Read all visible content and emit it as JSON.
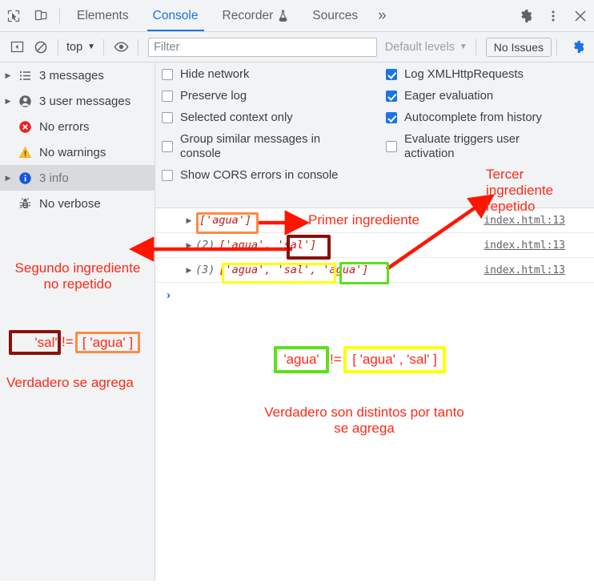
{
  "tabbar": {
    "icons": [
      "inspect-element-icon",
      "device-toolbar-icon"
    ],
    "tabs": [
      {
        "label": "Elements",
        "active": false
      },
      {
        "label": "Console",
        "active": true
      },
      {
        "label": "Recorder",
        "active": false,
        "badge": "flask-icon"
      },
      {
        "label": "Sources",
        "active": false
      }
    ],
    "more_tabs": "»",
    "settings_icon": "gear-icon",
    "kebab_icon": "more-vertical-icon",
    "close_icon": "close-icon"
  },
  "filterbar": {
    "sidebar_toggle_icon": "show-console-sidebar-icon",
    "clear_icon": "clear-console-icon",
    "context": "top",
    "context_caret": "▼",
    "eye_icon": "live-expression-icon",
    "filter_value": "",
    "filter_placeholder": "Filter",
    "levels_label": "Default levels",
    "levels_caret": "▼",
    "issues_label": "No Issues",
    "settings_icon": "console-settings-gear-icon"
  },
  "sidebar": {
    "items": [
      {
        "label": "3 messages",
        "icon": "list-icon",
        "expandable": true,
        "selected": false
      },
      {
        "label": "3 user messages",
        "icon": "user-icon",
        "expandable": true,
        "selected": false
      },
      {
        "label": "No errors",
        "icon": "error-icon",
        "expandable": false,
        "selected": false
      },
      {
        "label": "No warnings",
        "icon": "warning-icon",
        "expandable": false,
        "selected": false
      },
      {
        "label": "3 info",
        "icon": "info-icon",
        "expandable": true,
        "selected": true
      },
      {
        "label": "No verbose",
        "icon": "bug-icon",
        "expandable": false,
        "selected": false
      }
    ]
  },
  "settings": {
    "left": [
      {
        "label": "Hide network",
        "checked": false
      },
      {
        "label": "Preserve log",
        "checked": false
      },
      {
        "label": "Selected context only",
        "checked": false
      },
      {
        "label": "Group similar messages in\nconsole",
        "checked": false,
        "two_line": true
      },
      {
        "label": "Show CORS errors in console",
        "checked": false
      }
    ],
    "right": [
      {
        "label": "Log XMLHttpRequests",
        "checked": true
      },
      {
        "label": "Eager evaluation",
        "checked": true
      },
      {
        "label": "Autocomplete from history",
        "checked": true
      },
      {
        "label": "Evaluate triggers user\nactivation",
        "checked": false,
        "two_line": true
      }
    ]
  },
  "console_log": {
    "rows": [
      {
        "count": "",
        "text": "['agua']",
        "source": "index.html:13"
      },
      {
        "count": "(2)",
        "text": "['agua', 'sal']",
        "source": "index.html:13"
      },
      {
        "count": "(3)",
        "text": "['agua', 'sal', 'agua']",
        "source": "index.html:13"
      }
    ],
    "prompt": "›"
  },
  "annotations": {
    "colors": {
      "red": "#ff2a18",
      "orange": "#fb8c46",
      "darkred": "#8b1008",
      "yellow": "#ffff00",
      "green": "#5ce01a"
    },
    "primer": "Primer ingrediente",
    "tercer": "Tercer\ningrediente\nrepetido",
    "segundo": "Segundo ingrediente\nno repetido",
    "expr_left_a": "'sal'",
    "expr_left_op": "!=",
    "expr_left_b": "[ 'agua' ]",
    "verdadero_left": "Verdadero se agrega",
    "expr_mid_a": "'agua'",
    "expr_mid_op": "!=",
    "expr_mid_b": "[ 'agua' , 'sal' ]",
    "verdadero_mid": "Verdadero son distintos por tanto\nse agrega"
  }
}
